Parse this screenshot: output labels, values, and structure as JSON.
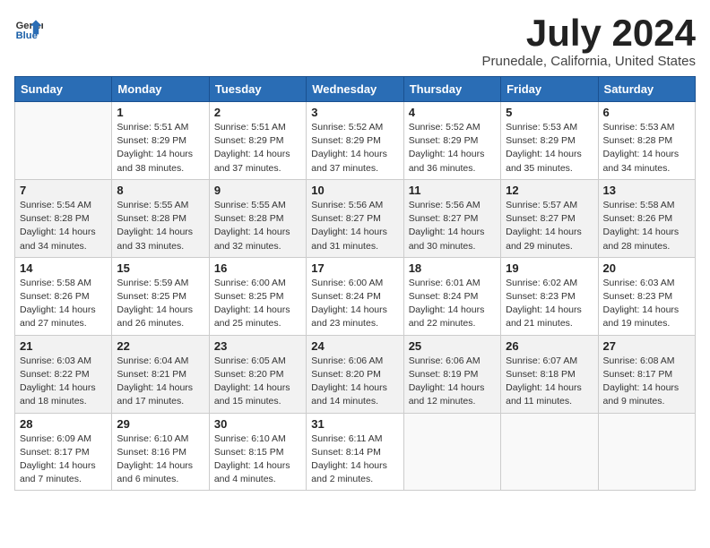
{
  "logo": {
    "text_general": "General",
    "text_blue": "Blue"
  },
  "title": {
    "month_year": "July 2024",
    "location": "Prunedale, California, United States"
  },
  "headers": [
    "Sunday",
    "Monday",
    "Tuesday",
    "Wednesday",
    "Thursday",
    "Friday",
    "Saturday"
  ],
  "weeks": [
    [
      {
        "day": "",
        "sunrise": "",
        "sunset": "",
        "daylight": ""
      },
      {
        "day": "1",
        "sunrise": "Sunrise: 5:51 AM",
        "sunset": "Sunset: 8:29 PM",
        "daylight": "Daylight: 14 hours and 38 minutes."
      },
      {
        "day": "2",
        "sunrise": "Sunrise: 5:51 AM",
        "sunset": "Sunset: 8:29 PM",
        "daylight": "Daylight: 14 hours and 37 minutes."
      },
      {
        "day": "3",
        "sunrise": "Sunrise: 5:52 AM",
        "sunset": "Sunset: 8:29 PM",
        "daylight": "Daylight: 14 hours and 37 minutes."
      },
      {
        "day": "4",
        "sunrise": "Sunrise: 5:52 AM",
        "sunset": "Sunset: 8:29 PM",
        "daylight": "Daylight: 14 hours and 36 minutes."
      },
      {
        "day": "5",
        "sunrise": "Sunrise: 5:53 AM",
        "sunset": "Sunset: 8:29 PM",
        "daylight": "Daylight: 14 hours and 35 minutes."
      },
      {
        "day": "6",
        "sunrise": "Sunrise: 5:53 AM",
        "sunset": "Sunset: 8:28 PM",
        "daylight": "Daylight: 14 hours and 34 minutes."
      }
    ],
    [
      {
        "day": "7",
        "sunrise": "Sunrise: 5:54 AM",
        "sunset": "Sunset: 8:28 PM",
        "daylight": "Daylight: 14 hours and 34 minutes."
      },
      {
        "day": "8",
        "sunrise": "Sunrise: 5:55 AM",
        "sunset": "Sunset: 8:28 PM",
        "daylight": "Daylight: 14 hours and 33 minutes."
      },
      {
        "day": "9",
        "sunrise": "Sunrise: 5:55 AM",
        "sunset": "Sunset: 8:28 PM",
        "daylight": "Daylight: 14 hours and 32 minutes."
      },
      {
        "day": "10",
        "sunrise": "Sunrise: 5:56 AM",
        "sunset": "Sunset: 8:27 PM",
        "daylight": "Daylight: 14 hours and 31 minutes."
      },
      {
        "day": "11",
        "sunrise": "Sunrise: 5:56 AM",
        "sunset": "Sunset: 8:27 PM",
        "daylight": "Daylight: 14 hours and 30 minutes."
      },
      {
        "day": "12",
        "sunrise": "Sunrise: 5:57 AM",
        "sunset": "Sunset: 8:27 PM",
        "daylight": "Daylight: 14 hours and 29 minutes."
      },
      {
        "day": "13",
        "sunrise": "Sunrise: 5:58 AM",
        "sunset": "Sunset: 8:26 PM",
        "daylight": "Daylight: 14 hours and 28 minutes."
      }
    ],
    [
      {
        "day": "14",
        "sunrise": "Sunrise: 5:58 AM",
        "sunset": "Sunset: 8:26 PM",
        "daylight": "Daylight: 14 hours and 27 minutes."
      },
      {
        "day": "15",
        "sunrise": "Sunrise: 5:59 AM",
        "sunset": "Sunset: 8:25 PM",
        "daylight": "Daylight: 14 hours and 26 minutes."
      },
      {
        "day": "16",
        "sunrise": "Sunrise: 6:00 AM",
        "sunset": "Sunset: 8:25 PM",
        "daylight": "Daylight: 14 hours and 25 minutes."
      },
      {
        "day": "17",
        "sunrise": "Sunrise: 6:00 AM",
        "sunset": "Sunset: 8:24 PM",
        "daylight": "Daylight: 14 hours and 23 minutes."
      },
      {
        "day": "18",
        "sunrise": "Sunrise: 6:01 AM",
        "sunset": "Sunset: 8:24 PM",
        "daylight": "Daylight: 14 hours and 22 minutes."
      },
      {
        "day": "19",
        "sunrise": "Sunrise: 6:02 AM",
        "sunset": "Sunset: 8:23 PM",
        "daylight": "Daylight: 14 hours and 21 minutes."
      },
      {
        "day": "20",
        "sunrise": "Sunrise: 6:03 AM",
        "sunset": "Sunset: 8:23 PM",
        "daylight": "Daylight: 14 hours and 19 minutes."
      }
    ],
    [
      {
        "day": "21",
        "sunrise": "Sunrise: 6:03 AM",
        "sunset": "Sunset: 8:22 PM",
        "daylight": "Daylight: 14 hours and 18 minutes."
      },
      {
        "day": "22",
        "sunrise": "Sunrise: 6:04 AM",
        "sunset": "Sunset: 8:21 PM",
        "daylight": "Daylight: 14 hours and 17 minutes."
      },
      {
        "day": "23",
        "sunrise": "Sunrise: 6:05 AM",
        "sunset": "Sunset: 8:20 PM",
        "daylight": "Daylight: 14 hours and 15 minutes."
      },
      {
        "day": "24",
        "sunrise": "Sunrise: 6:06 AM",
        "sunset": "Sunset: 8:20 PM",
        "daylight": "Daylight: 14 hours and 14 minutes."
      },
      {
        "day": "25",
        "sunrise": "Sunrise: 6:06 AM",
        "sunset": "Sunset: 8:19 PM",
        "daylight": "Daylight: 14 hours and 12 minutes."
      },
      {
        "day": "26",
        "sunrise": "Sunrise: 6:07 AM",
        "sunset": "Sunset: 8:18 PM",
        "daylight": "Daylight: 14 hours and 11 minutes."
      },
      {
        "day": "27",
        "sunrise": "Sunrise: 6:08 AM",
        "sunset": "Sunset: 8:17 PM",
        "daylight": "Daylight: 14 hours and 9 minutes."
      }
    ],
    [
      {
        "day": "28",
        "sunrise": "Sunrise: 6:09 AM",
        "sunset": "Sunset: 8:17 PM",
        "daylight": "Daylight: 14 hours and 7 minutes."
      },
      {
        "day": "29",
        "sunrise": "Sunrise: 6:10 AM",
        "sunset": "Sunset: 8:16 PM",
        "daylight": "Daylight: 14 hours and 6 minutes."
      },
      {
        "day": "30",
        "sunrise": "Sunrise: 6:10 AM",
        "sunset": "Sunset: 8:15 PM",
        "daylight": "Daylight: 14 hours and 4 minutes."
      },
      {
        "day": "31",
        "sunrise": "Sunrise: 6:11 AM",
        "sunset": "Sunset: 8:14 PM",
        "daylight": "Daylight: 14 hours and 2 minutes."
      },
      {
        "day": "",
        "sunrise": "",
        "sunset": "",
        "daylight": ""
      },
      {
        "day": "",
        "sunrise": "",
        "sunset": "",
        "daylight": ""
      },
      {
        "day": "",
        "sunrise": "",
        "sunset": "",
        "daylight": ""
      }
    ]
  ]
}
